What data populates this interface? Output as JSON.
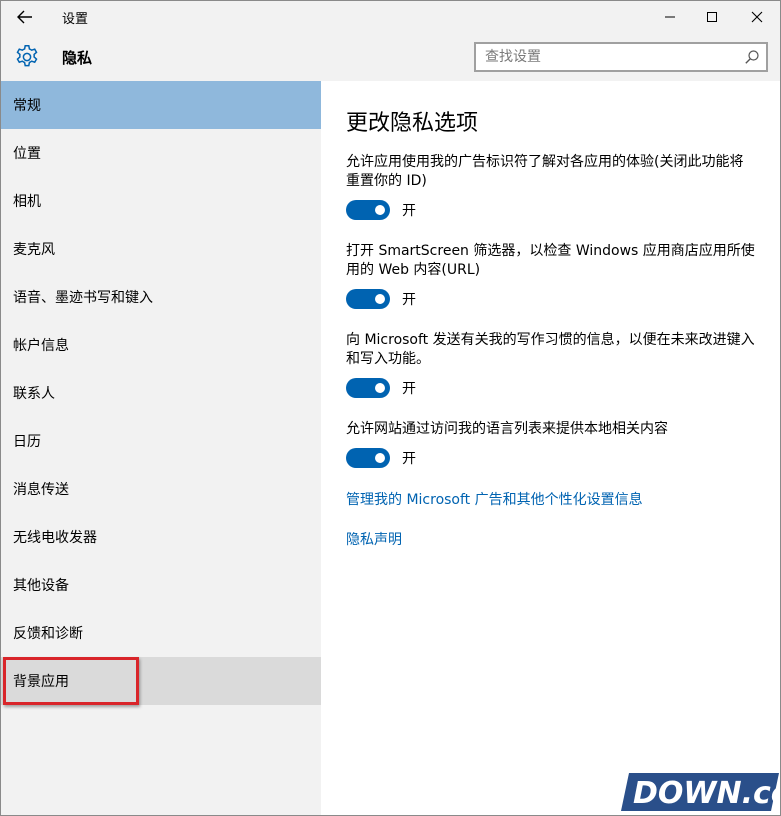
{
  "window": {
    "title": "设置"
  },
  "header": {
    "section": "隐私",
    "search_placeholder": "查找设置"
  },
  "sidebar": {
    "items": [
      {
        "label": "常规",
        "state": "selected"
      },
      {
        "label": "位置"
      },
      {
        "label": "相机"
      },
      {
        "label": "麦克风"
      },
      {
        "label": "语音、墨迹书写和键入"
      },
      {
        "label": "帐户信息"
      },
      {
        "label": "联系人"
      },
      {
        "label": "日历"
      },
      {
        "label": "消息传送"
      },
      {
        "label": "无线电收发器"
      },
      {
        "label": "其他设备"
      },
      {
        "label": "反馈和诊断"
      },
      {
        "label": "背景应用",
        "state": "hover-highlighted"
      }
    ]
  },
  "content": {
    "heading": "更改隐私选项",
    "settings": [
      {
        "description": "允许应用使用我的广告标识符了解对各应用的体验(关闭此功能将重置你的 ID)",
        "toggle_state": "开"
      },
      {
        "description": "打开 SmartScreen 筛选器，以检查 Windows 应用商店应用所使用的 Web 内容(URL)",
        "toggle_state": "开"
      },
      {
        "description": "向 Microsoft 发送有关我的写作习惯的信息，以便在未来改进键入和写入功能。",
        "toggle_state": "开"
      },
      {
        "description": "允许网站通过访问我的语言列表来提供本地相关内容",
        "toggle_state": "开"
      }
    ],
    "links": [
      "管理我的 Microsoft 广告和其他个性化设置信息",
      "隐私声明"
    ]
  },
  "watermark": {
    "text": "DOWN.cc"
  },
  "colors": {
    "accent": "#0063b1",
    "selected_nav": "#8fb8dc",
    "highlight_box": "#d9252a",
    "sidebar_bg": "#f2f2f2"
  }
}
